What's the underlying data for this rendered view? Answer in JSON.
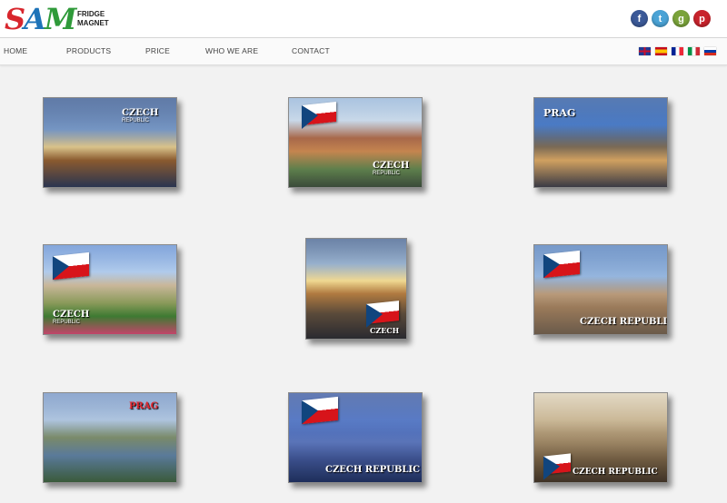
{
  "brand": {
    "logo_s": "S",
    "logo_a": "A",
    "logo_m": "M",
    "logo_line1": "FRIDGE",
    "logo_line2": "MAGNET"
  },
  "social": [
    {
      "icon": "facebook-icon",
      "glyph": "f",
      "color": "#3b5998"
    },
    {
      "icon": "twitter-icon",
      "glyph": "t",
      "color": "#4aa3d6"
    },
    {
      "icon": "google-icon",
      "glyph": "g",
      "color": "#7aa33a"
    },
    {
      "icon": "pinterest-icon",
      "glyph": "p",
      "color": "#c8232c"
    }
  ],
  "nav": {
    "home": "HOME",
    "products": "PRODUCTS",
    "price": "PRICE",
    "who": "WHO WE ARE",
    "contact": "CONTACT"
  },
  "languages": [
    "en",
    "es",
    "fr",
    "it",
    "ru"
  ],
  "magnets": [
    {
      "caption": "CZECH",
      "subcaption": "REPUBLIC",
      "scene": "parliament-at-dusk"
    },
    {
      "caption": "CZECH",
      "subcaption": "REPUBLIC",
      "scene": "prague-rooftops-with-flag-map"
    },
    {
      "caption": "PRAG",
      "subcaption": "",
      "scene": "chain-bridge-lion"
    },
    {
      "caption": "CZECH",
      "subcaption": "REPUBLIC",
      "scene": "castle-with-flowers"
    },
    {
      "caption": "CZECH",
      "subcaption": "",
      "scene": "charles-bridge-sunset"
    },
    {
      "caption": "CZECH REPUBLIC",
      "subcaption": "",
      "scene": "old-town-square"
    },
    {
      "caption": "PRAG",
      "subcaption": "",
      "scene": "vltava-bridges"
    },
    {
      "caption": "CZECH REPUBLIC",
      "subcaption": "",
      "scene": "charles-bridge-night"
    },
    {
      "caption": "CZECH REPUBLIC",
      "subcaption": "",
      "scene": "misty-statues-sepia"
    }
  ]
}
